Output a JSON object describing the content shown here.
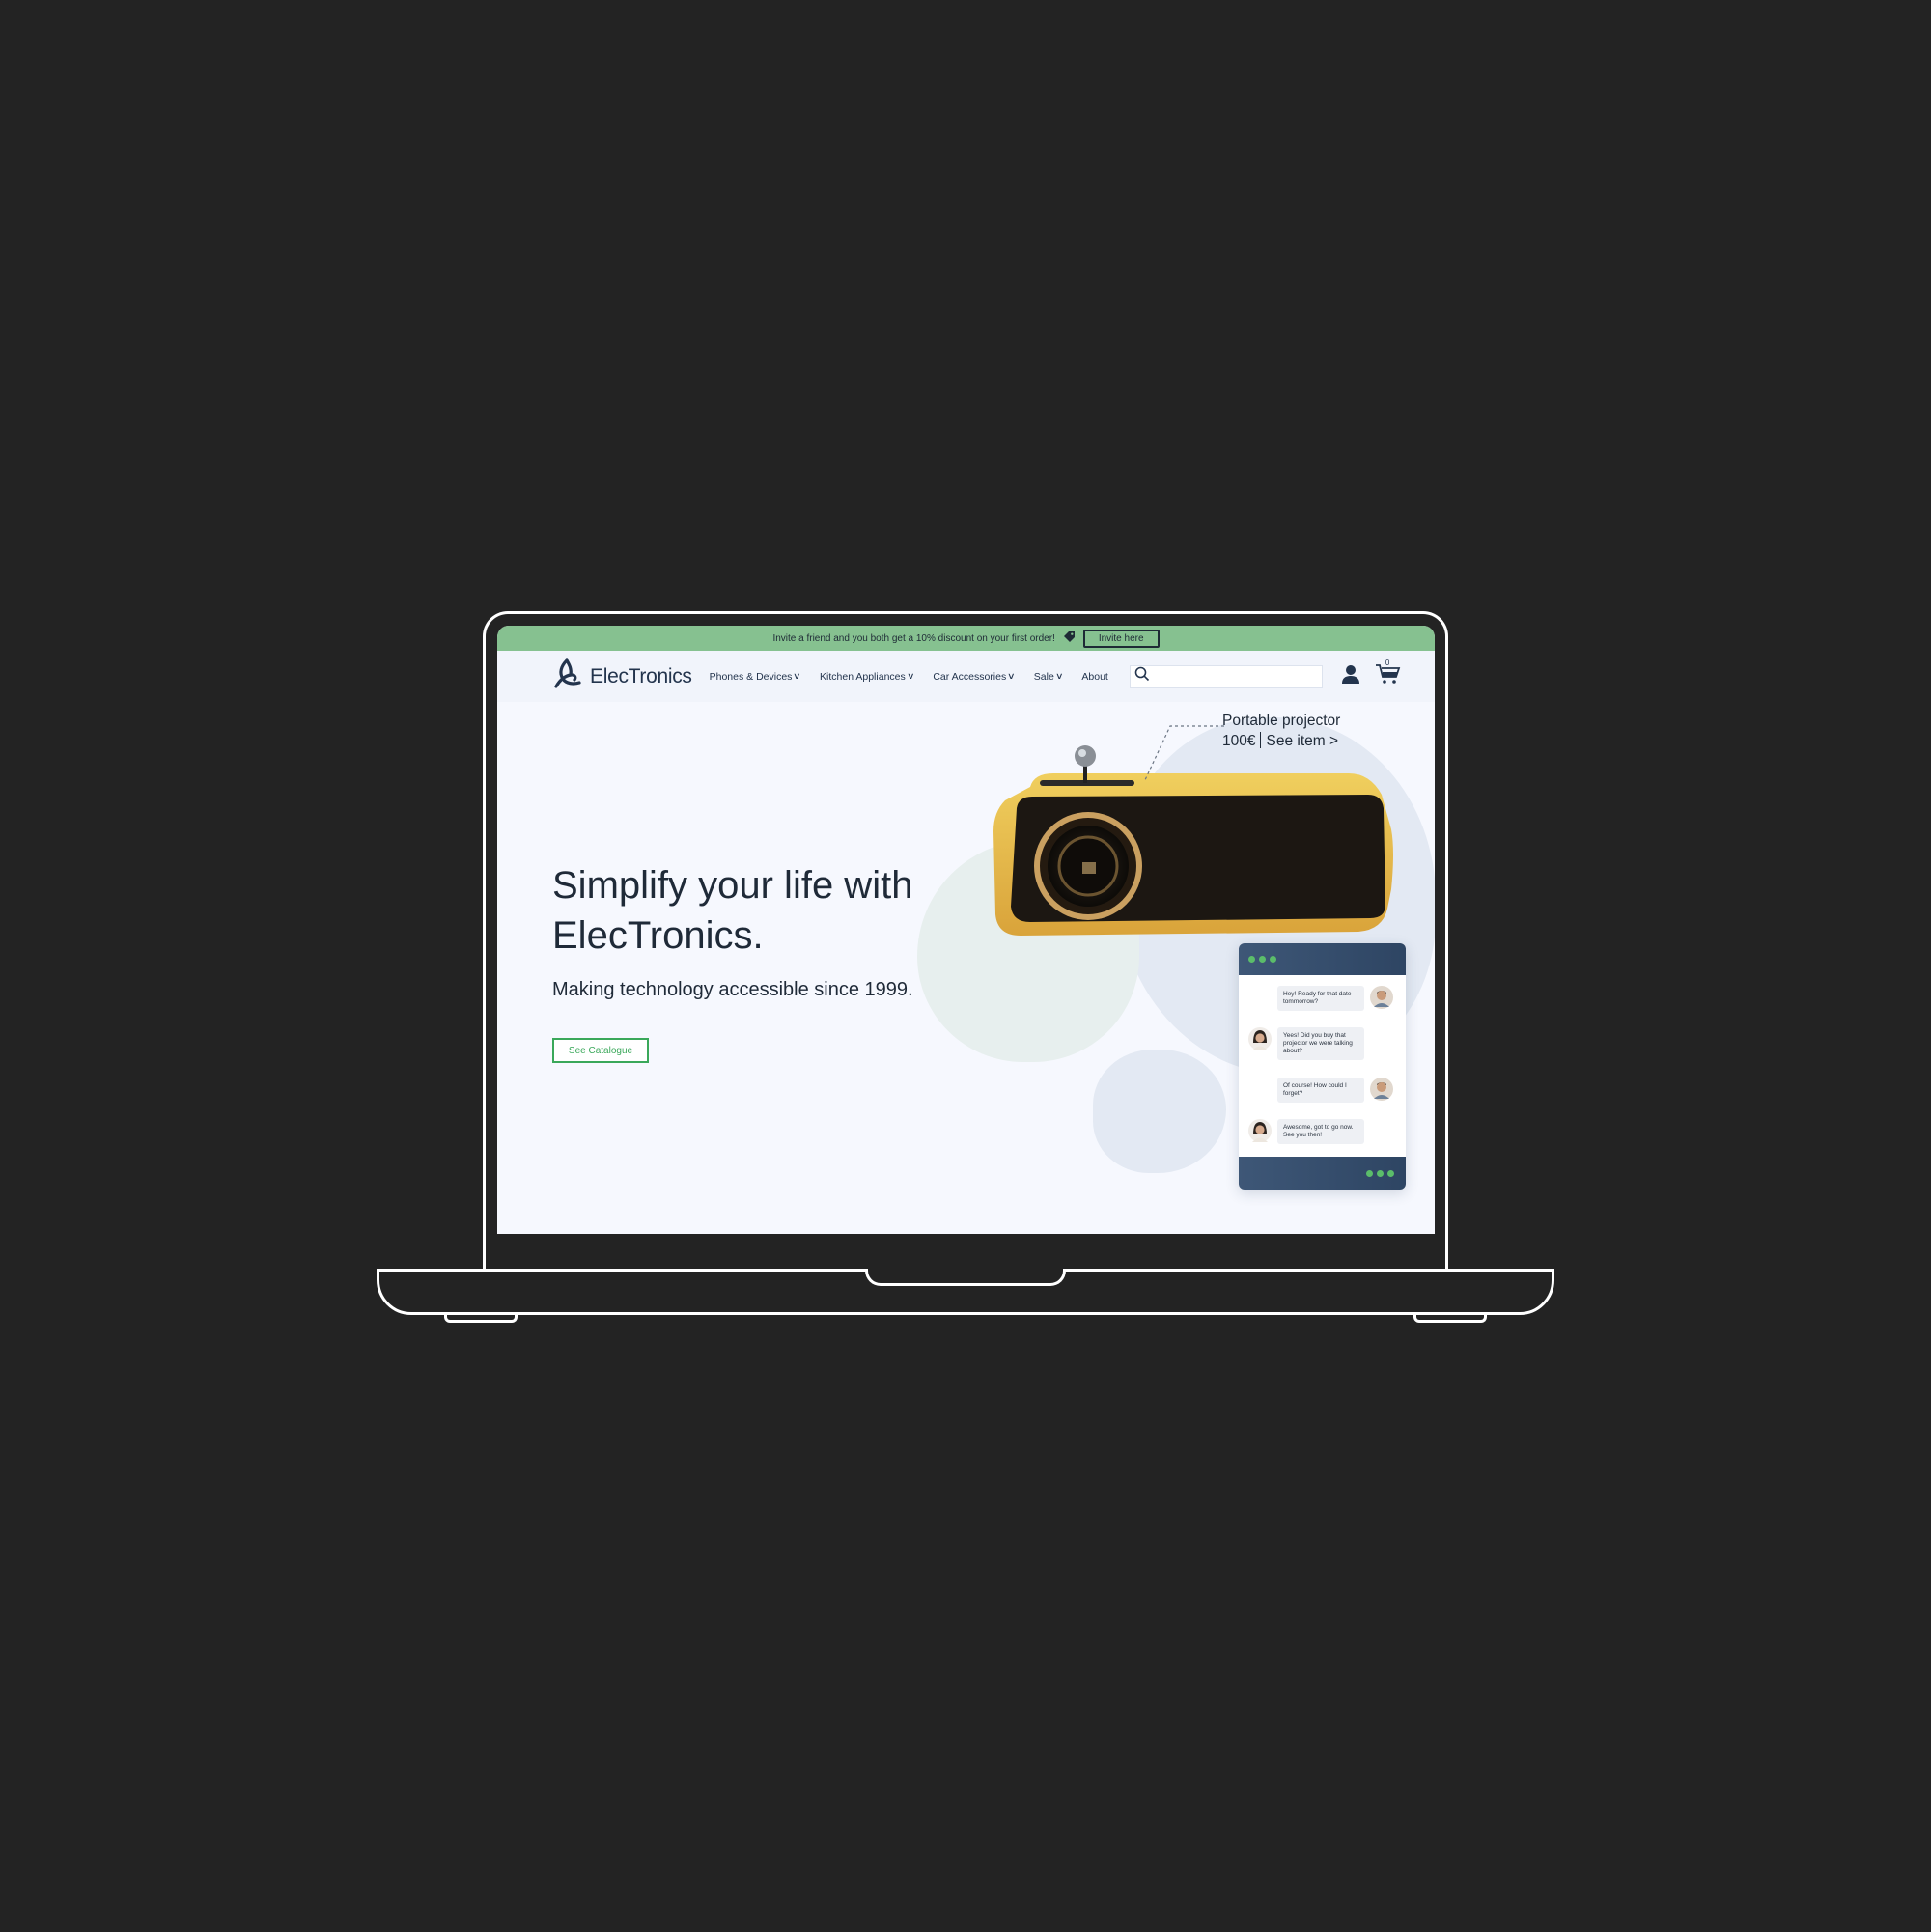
{
  "promo": {
    "text": "Invite a friend and you both get a 10% discount on your first order!",
    "button_label": "Invite here"
  },
  "nav": {
    "brand": "ElecTronics",
    "items": [
      {
        "label": "Phones & Devices",
        "dropdown": true
      },
      {
        "label": "Kitchen Appliances",
        "dropdown": true
      },
      {
        "label": "Car Accessories",
        "dropdown": true
      },
      {
        "label": "Sale",
        "dropdown": true
      },
      {
        "label": "About",
        "dropdown": false
      }
    ],
    "search_placeholder": "",
    "cart_count": "0"
  },
  "hero": {
    "title": "Simplify your life with ElecTronics.",
    "subtitle": "Making technology accessible since 1999.",
    "cta_label": "See Catalogue"
  },
  "product_callout": {
    "name": "Portable projector",
    "price": "100€",
    "link": "See item >"
  },
  "chat": {
    "messages": [
      {
        "sender": "right",
        "text": "Hey! Ready for that date tommorrow?"
      },
      {
        "sender": "left",
        "text": "Yees! Did you buy that projector we were talking about?"
      },
      {
        "sender": "right",
        "text": "Of course! How could I forget?"
      },
      {
        "sender": "left",
        "text": "Awesome, got to go now. See you then!"
      }
    ]
  },
  "colors": {
    "background": "#232323",
    "promo_bar": "#86c190",
    "accent_green": "#3aa85a",
    "text_dark": "#1f2a38",
    "chat_header": "#3e5777"
  }
}
